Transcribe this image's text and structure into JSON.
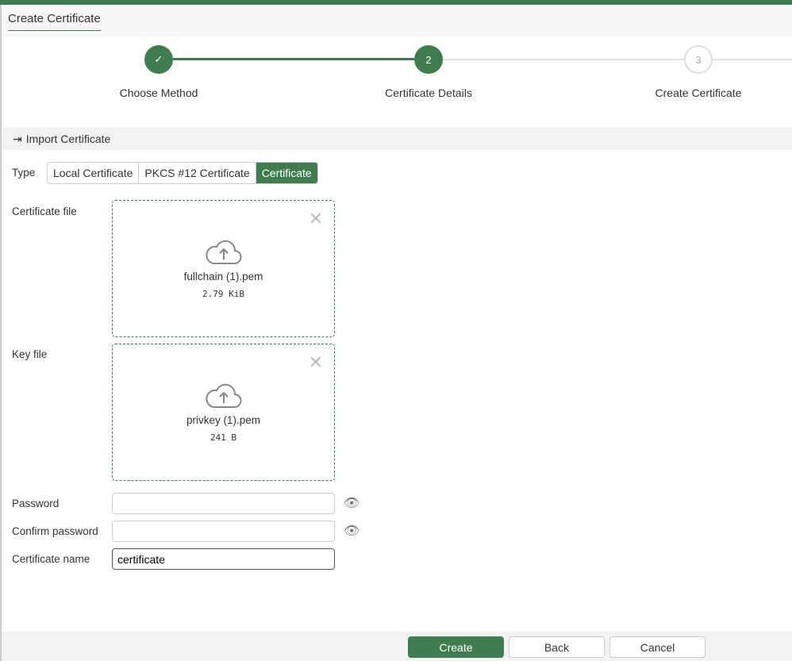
{
  "title": "Create Certificate",
  "steps": [
    {
      "label": "Choose Method",
      "state": "done",
      "number": "1"
    },
    {
      "label": "Certificate Details",
      "state": "active",
      "number": "2"
    },
    {
      "label": "Create Certificate",
      "state": "todo",
      "number": "3"
    }
  ],
  "section": "Import Certificate",
  "type": {
    "label": "Type",
    "options": [
      "Local Certificate",
      "PKCS #12 Certificate",
      "Certificate"
    ],
    "selected": "Certificate"
  },
  "cert_file": {
    "label": "Certificate file",
    "name": "fullchain (1).pem",
    "size": "2.79 KiB"
  },
  "key_file": {
    "label": "Key file",
    "name": "privkey (1).pem",
    "size": "241 B"
  },
  "password": {
    "label": "Password",
    "value": ""
  },
  "confirm": {
    "label": "Confirm password",
    "value": ""
  },
  "cert_name": {
    "label": "Certificate name",
    "value": "certificate"
  },
  "buttons": {
    "create": "Create",
    "back": "Back",
    "cancel": "Cancel"
  },
  "colors": {
    "accent": "#3f7d4f"
  }
}
